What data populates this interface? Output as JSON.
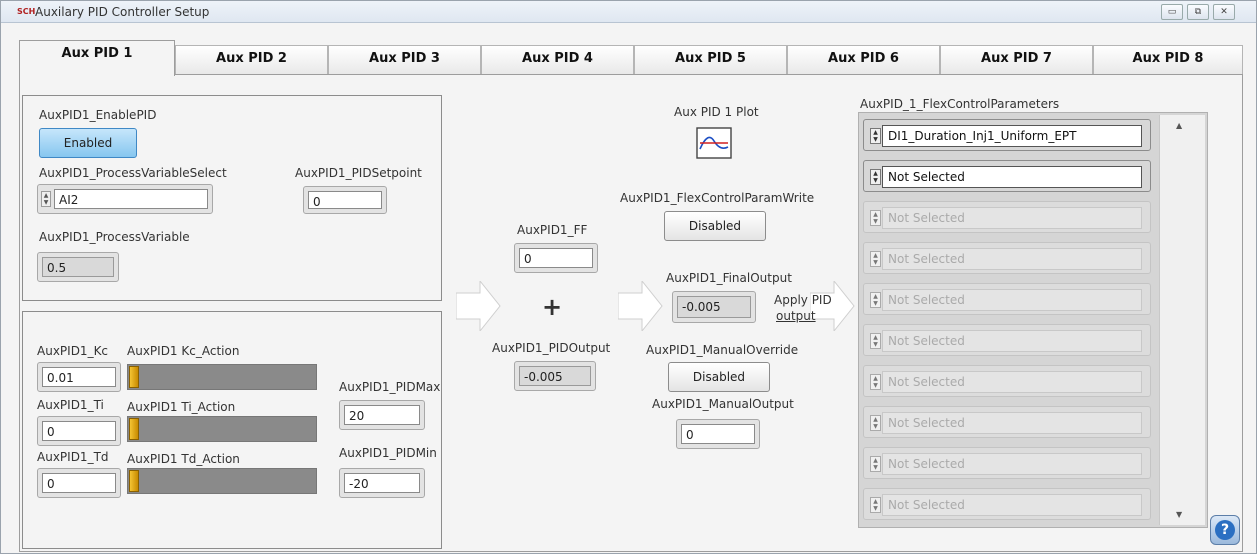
{
  "window": {
    "title": "Auxilary PID Controller Setup",
    "icon_text": "SCH"
  },
  "window_controls": {
    "minimize": "▭",
    "maximize": "⧉",
    "close": "✕"
  },
  "tabs": [
    {
      "label": "Aux PID 1",
      "active": true
    },
    {
      "label": "Aux PID 2"
    },
    {
      "label": "Aux PID 3"
    },
    {
      "label": "Aux PID 4"
    },
    {
      "label": "Aux PID 5"
    },
    {
      "label": "Aux PID 6"
    },
    {
      "label": "Aux PID 7"
    },
    {
      "label": "Aux PID 8"
    }
  ],
  "enable": {
    "label": "AuxPID1_EnablePID",
    "button": "Enabled"
  },
  "pv_select": {
    "label": "AuxPID1_ProcessVariableSelect",
    "value": "AI2"
  },
  "setpoint": {
    "label": "AuxPID1_PIDSetpoint",
    "value": "0"
  },
  "pv": {
    "label": "AuxPID1_ProcessVariable",
    "value": "0.5"
  },
  "kc": {
    "label": "AuxPID1_Kc",
    "value": "0.01",
    "action_label": "AuxPID1 Kc_Action"
  },
  "ti": {
    "label": "AuxPID1_Ti",
    "value": "0",
    "action_label": "AuxPID1 Ti_Action"
  },
  "td": {
    "label": "AuxPID1_Td",
    "value": "0",
    "action_label": "AuxPID1 Td_Action"
  },
  "pid_max": {
    "label": "AuxPID1_PIDMax",
    "value": "20"
  },
  "pid_min": {
    "label": "AuxPID1_PIDMin",
    "value": "-20"
  },
  "ff": {
    "label": "AuxPID1_FF",
    "value": "0"
  },
  "sum_symbol": "+",
  "pid_output": {
    "label": "AuxPID1_PIDOutput",
    "value": "-0.005"
  },
  "plot": {
    "label": "Aux PID 1 Plot"
  },
  "flex_write": {
    "label": "AuxPID1_FlexControlParamWrite",
    "button": "Disabled"
  },
  "final_output": {
    "label": "AuxPID1_FinalOutput",
    "value": "-0.005"
  },
  "apply": {
    "line1": "Apply PID",
    "line2": "output"
  },
  "manual_override": {
    "label": "AuxPID1_ManualOverride",
    "button": "Disabled"
  },
  "manual_output": {
    "label": "AuxPID1_ManualOutput",
    "value": "0"
  },
  "flex": {
    "label": "AuxPID_1_FlexControlParameters",
    "items": [
      {
        "value": "DI1_Duration_Inj1_Uniform_EPT",
        "enabled": true
      },
      {
        "value": "Not Selected",
        "enabled": true
      },
      {
        "value": "Not Selected",
        "enabled": false
      },
      {
        "value": "Not Selected",
        "enabled": false
      },
      {
        "value": "Not Selected",
        "enabled": false
      },
      {
        "value": "Not Selected",
        "enabled": false
      },
      {
        "value": "Not Selected",
        "enabled": false
      },
      {
        "value": "Not Selected",
        "enabled": false
      },
      {
        "value": "Not Selected",
        "enabled": false
      },
      {
        "value": "Not Selected",
        "enabled": false
      }
    ]
  },
  "help": {
    "icon": "?"
  },
  "colors": {
    "enabled_button": "#86c6ef",
    "slider_thumb": "#f4c433",
    "arrow": "#ffffff"
  }
}
